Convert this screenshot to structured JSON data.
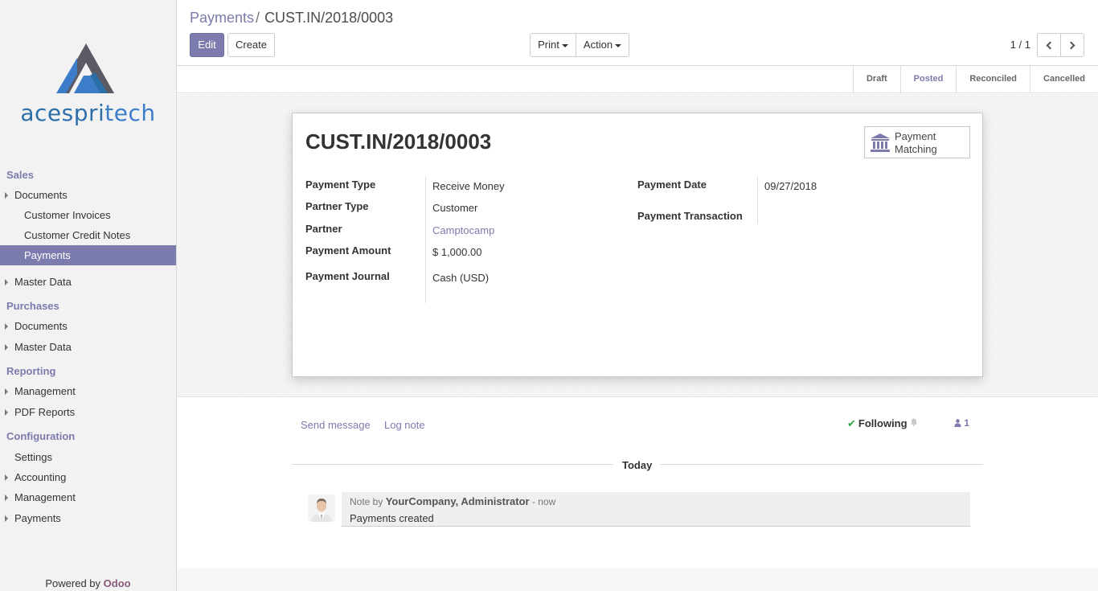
{
  "brand": {
    "name_part1": "acespri",
    "name_part2": "tech",
    "powered_label": "Powered by",
    "powered_brand": "Odoo"
  },
  "sidebar": {
    "sections": [
      {
        "title": "Sales",
        "items": [
          {
            "label": "Documents",
            "caret": true
          },
          {
            "label": "Customer Invoices",
            "sub": true
          },
          {
            "label": "Customer Credit Notes",
            "sub": true
          },
          {
            "label": "Payments",
            "sub": true,
            "active": true
          },
          {
            "label": "Master Data",
            "caret": true
          }
        ]
      },
      {
        "title": "Purchases",
        "items": [
          {
            "label": "Documents",
            "caret": true
          },
          {
            "label": "Master Data",
            "caret": true
          }
        ]
      },
      {
        "title": "Reporting",
        "items": [
          {
            "label": "Management",
            "caret": true
          },
          {
            "label": "PDF Reports",
            "caret": true
          }
        ]
      },
      {
        "title": "Configuration",
        "items": [
          {
            "label": "Settings"
          },
          {
            "label": "Accounting",
            "caret": true
          },
          {
            "label": "Management",
            "caret": true
          },
          {
            "label": "Payments",
            "caret": true
          }
        ]
      }
    ]
  },
  "breadcrumb": {
    "parent": "Payments",
    "separator": "/",
    "current": "CUST.IN/2018/0003"
  },
  "toolbar": {
    "edit_label": "Edit",
    "create_label": "Create",
    "print_label": "Print",
    "action_label": "Action"
  },
  "pager": {
    "value": "1 / 1"
  },
  "status": {
    "steps": [
      "Draft",
      "Posted",
      "Reconciled",
      "Cancelled"
    ],
    "active": "Posted"
  },
  "form": {
    "title": "CUST.IN/2018/0003",
    "smart_button": {
      "line1": "Payment",
      "line2": "Matching",
      "icon": "bank-icon"
    },
    "left_fields": [
      {
        "label": "Payment Type",
        "value": "Receive Money"
      },
      {
        "label": "Partner Type",
        "value": "Customer"
      },
      {
        "label": "Partner",
        "value": "Camptocamp"
      },
      {
        "label": "Payment Amount",
        "value": "$ 1,000.00"
      },
      {
        "label": "Payment Journal",
        "value": "Cash (USD)"
      }
    ],
    "right_fields": [
      {
        "label": "Payment Date",
        "value": "09/27/2018"
      },
      {
        "label": "Payment Transaction",
        "value": ""
      }
    ]
  },
  "chatter": {
    "send_message": "Send message",
    "log_note": "Log note",
    "following": "Following",
    "followers_count": "1",
    "today": "Today",
    "message": {
      "prefix": "Note by",
      "author": "YourCompany, Administrator",
      "time": "- now",
      "body": "Payments created"
    }
  },
  "colors": {
    "primary": "#7c7bad",
    "brand_blue": "#2c6fa8",
    "check_green": "#28a745"
  }
}
